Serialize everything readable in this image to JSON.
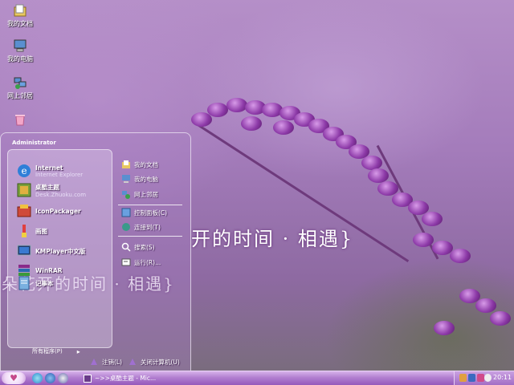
{
  "desktop": {
    "icons": [
      {
        "label": "我的文档",
        "icon": "my-documents-icon"
      },
      {
        "label": "我的电脑",
        "icon": "my-computer-icon"
      },
      {
        "label": "网上邻居",
        "icon": "network-places-icon"
      },
      {
        "label": "",
        "icon": "recycle-bin-icon"
      }
    ],
    "slogan_large": "开的时间 · 相遇}",
    "slogan_small": "朵花开的时间 · 相遇}"
  },
  "start_menu": {
    "user": "Administrator",
    "pinned": [
      {
        "title": "Internet",
        "subtitle": "Internet Explorer",
        "icon": "internet-explorer-icon"
      },
      {
        "title": "桌酷主题",
        "subtitle": "Desk.Zhuoku.com",
        "icon": "zhuoku-theme-icon"
      }
    ],
    "recent": [
      {
        "title": "IconPackager",
        "icon": "iconpackager-icon"
      },
      {
        "title": "画图",
        "icon": "paint-icon"
      },
      {
        "title": "KMPlayer中文版",
        "icon": "kmplayer-icon"
      },
      {
        "title": "WinRAR",
        "icon": "winrar-icon"
      },
      {
        "title": "记事本",
        "icon": "notepad-icon"
      }
    ],
    "all_programs": "所有程序(P)",
    "right": [
      {
        "label": "我的文档",
        "icon": "my-documents-icon"
      },
      {
        "label": "我的电脑",
        "icon": "my-computer-icon"
      },
      {
        "label": "网上邻居",
        "icon": "network-places-icon"
      },
      {
        "label": "控制面板(C)",
        "icon": "control-panel-icon"
      },
      {
        "label": "连接到(T)",
        "icon": "connect-to-icon"
      },
      {
        "label": "搜索(S)",
        "icon": "search-icon"
      },
      {
        "label": "运行(R)...",
        "icon": "run-icon"
      }
    ],
    "logoff": "注销(L)",
    "shutdown": "关闭计算机(U)"
  },
  "taskbar": {
    "start_glyph": "♥",
    "task_label": "~>>桌酷主题 - Mic...",
    "clock": "20:11"
  },
  "colors": {
    "accent": "#9c6fb2",
    "taskbar": "#b27fd0"
  }
}
